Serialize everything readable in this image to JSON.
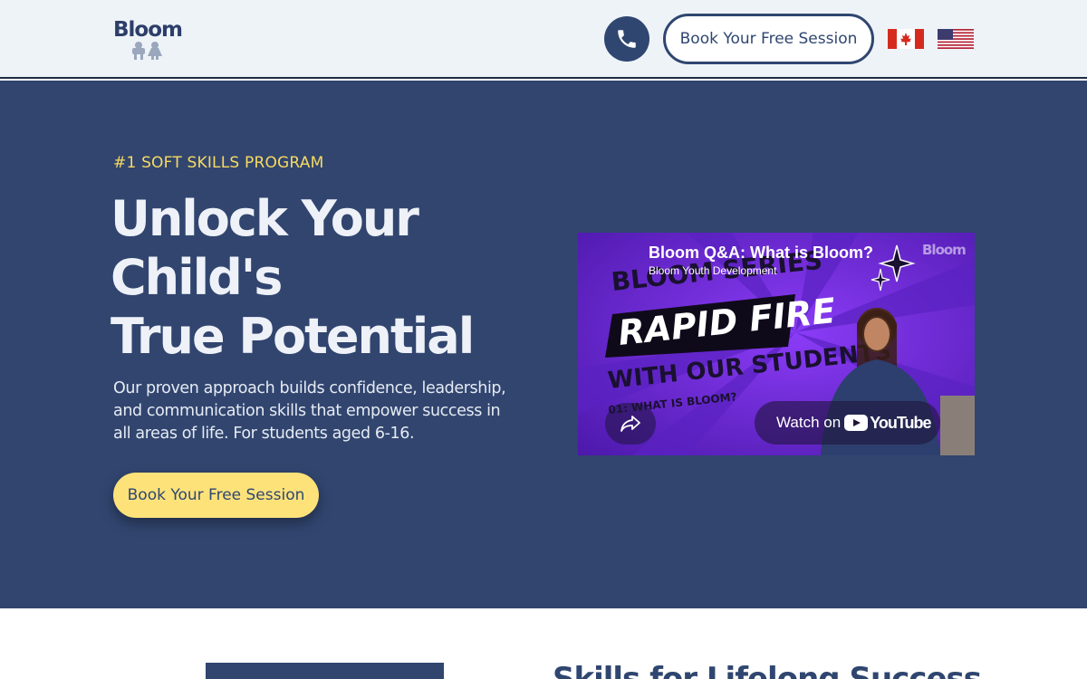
{
  "header": {
    "logo_text": "Bloom",
    "cta_label": "Book Your Free Session",
    "phone_icon": "phone-icon",
    "flags": [
      "canada-flag-icon",
      "us-flag-icon"
    ]
  },
  "hero": {
    "eyebrow": "#1 SOFT SKILLS PROGRAM",
    "title_lines": [
      "Unlock Your",
      "Child's",
      "True Potential"
    ],
    "description": "Our proven approach builds confidence, leadership, and communication skills that empower success in all areas of life. For students aged 6-16.",
    "cta_label": "Book Your Free Session"
  },
  "video": {
    "title": "Bloom Q&A: What is Bloom?",
    "channel": "Bloom Youth Development",
    "watermark": "Bloom",
    "thumb_line1": "BLOOM SERIES",
    "thumb_line2": "RAPID FIRE",
    "thumb_line3": "WITH OUR STUDENTS",
    "thumb_line4": "01: WHAT IS BLOOM?",
    "watch_label": "Watch on",
    "youtube_label": "YouTube"
  },
  "section2": {
    "heading": "Skills for Lifelong Success"
  },
  "colors": {
    "navy": "#31456f",
    "yellow": "#fde27a",
    "eyebrow": "#f7da62",
    "header_bg": "#eef3f8"
  }
}
